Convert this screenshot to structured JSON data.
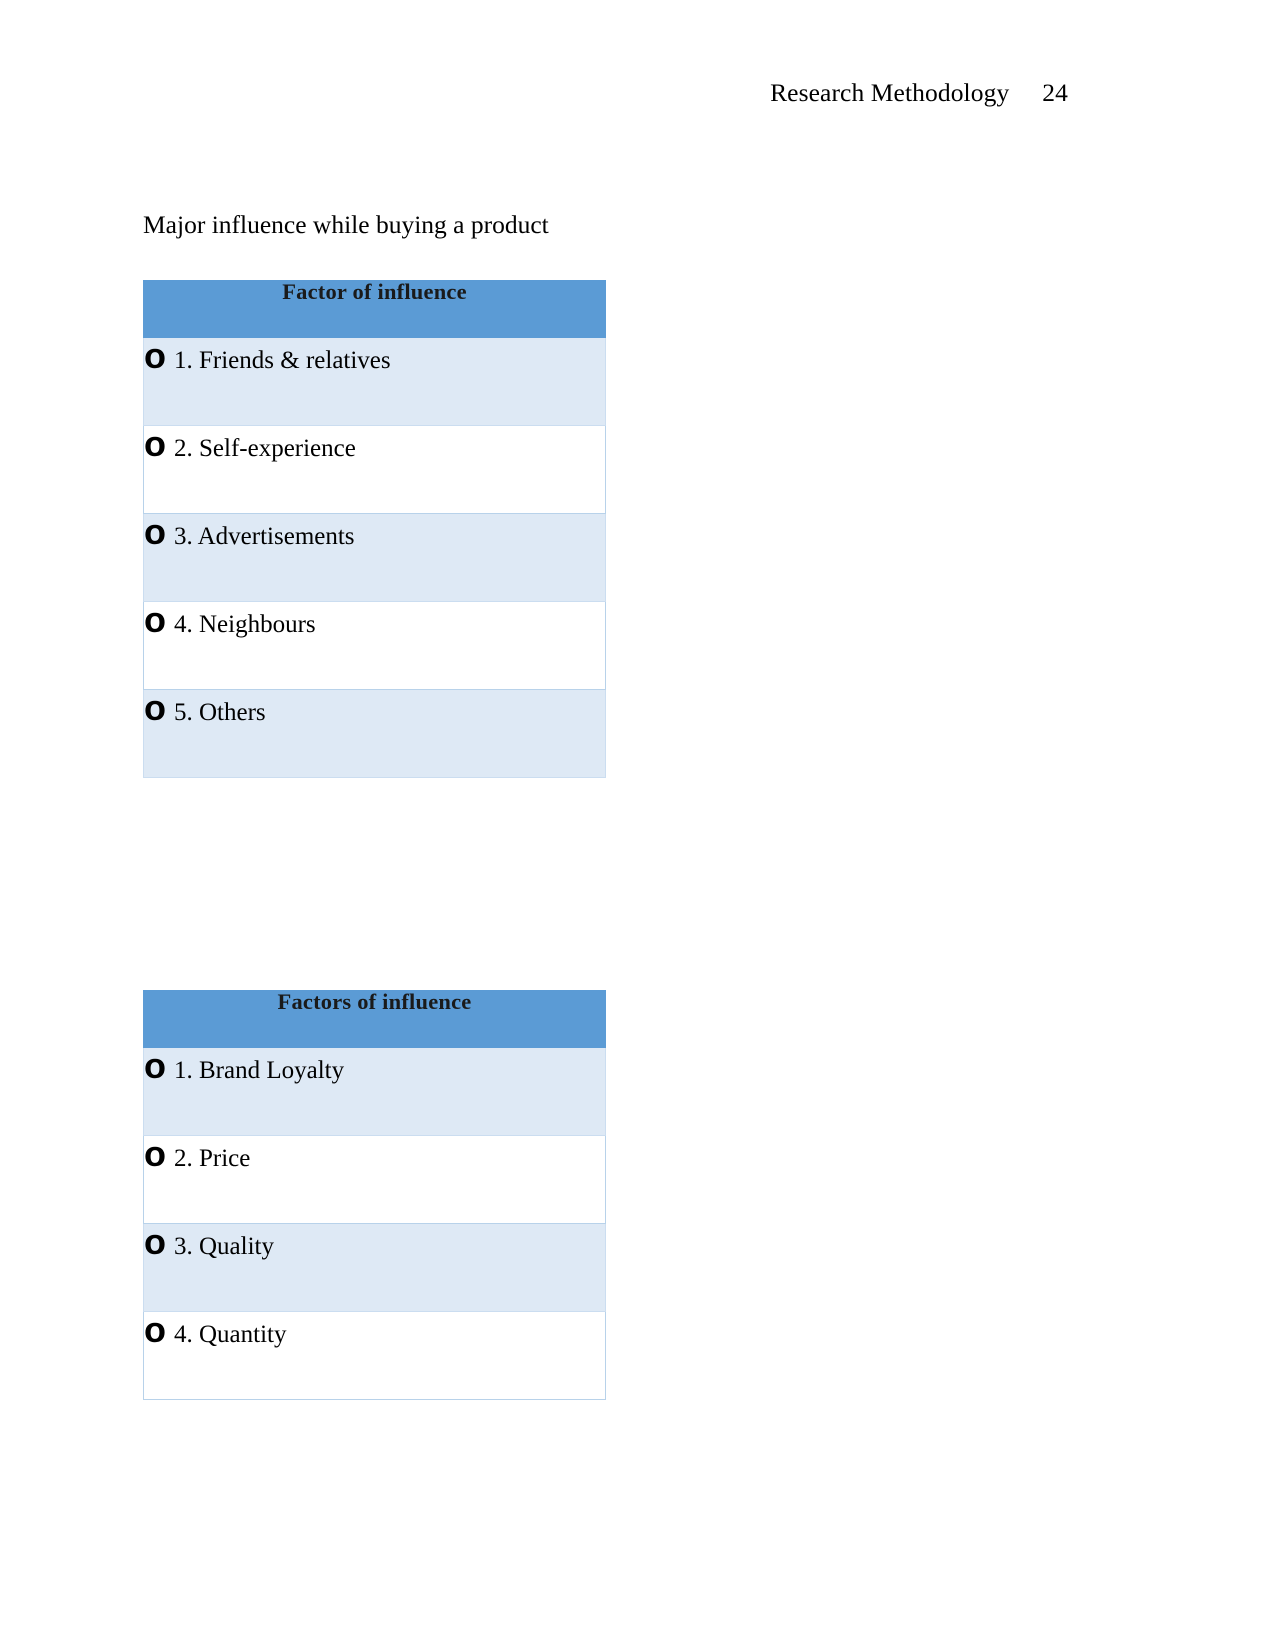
{
  "header": {
    "document_title": "Research Methodology",
    "page_number": "24"
  },
  "body": {
    "intro_paragraph": "Major influence while buying a product"
  },
  "colors": {
    "table_header_bg": "#5B9BD5",
    "row_shade_bg": "#DEE9F5",
    "row_plain_bg": "#FFFFFF",
    "row_border": "#B8D2EA",
    "text": "#000000"
  },
  "tables": [
    {
      "id": "factor-of-influence",
      "header": "Factor of influence",
      "bullet_glyph": "o",
      "options": [
        {
          "label": "1. Friends & relatives",
          "shaded": true
        },
        {
          "label": "2. Self-experience",
          "shaded": false
        },
        {
          "label": "3. Advertisements",
          "shaded": true
        },
        {
          "label": "4. Neighbours",
          "shaded": false
        },
        {
          "label": "5. Others",
          "shaded": true
        }
      ]
    },
    {
      "id": "factors-of-influence",
      "header": "Factors of influence",
      "bullet_glyph": "o",
      "options": [
        {
          "label": "1. Brand Loyalty",
          "shaded": true
        },
        {
          "label": "2. Price",
          "shaded": false
        },
        {
          "label": "3. Quality",
          "shaded": true
        },
        {
          "label": "4. Quantity",
          "shaded": false
        }
      ]
    }
  ]
}
